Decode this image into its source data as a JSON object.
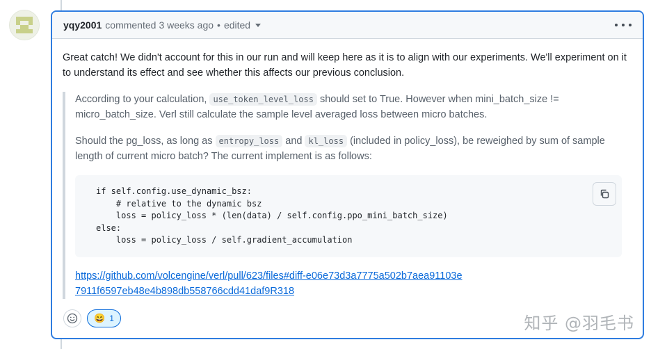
{
  "comment": {
    "author": "yqy2001",
    "action": "commented",
    "time": "3 weeks ago",
    "separator": "•",
    "edited_label": "edited",
    "body_paragraph": "Great catch! We didn't account for this in our run and will keep here as it is to align with our experiments. We'll experiment on it to understand its effect and see whether this affects our previous conclusion.",
    "quote": {
      "p1_part1": "According to your calculation, ",
      "p1_code": "use_token_level_loss",
      "p1_part2": " should set to True. However when mini_batch_size != micro_batch_size. Verl still calculate the sample level averaged loss between micro batches.",
      "p2_part1": "Should the pg_loss, as long as ",
      "p2_code1": "entropy_loss",
      "p2_part2": " and ",
      "p2_code2": "kl_loss",
      "p2_part3": " (included in policy_loss), be reweighed by sum of sample length of current micro batch? The current implement is as follows:",
      "code_block": "if self.config.use_dynamic_bsz:\n    # relative to the dynamic bsz\n    loss = policy_loss * (len(data) / self.config.ppo_mini_batch_size)\nelse:\n    loss = policy_loss / self.gradient_accumulation",
      "link": "https://github.com/volcengine/verl/pull/623/files#diff-e06e73d3a7775a502b7aea91103e7911f6597eb48e4b898db558766cdd41daf9R318"
    },
    "reactions": [
      {
        "emoji": "😄",
        "count": "1"
      }
    ]
  },
  "watermark": "知乎 @羽毛书",
  "icons": {
    "avatar": "identicon-avatar",
    "kebab": "kebab-horizontal-icon",
    "caret": "triangle-down-icon",
    "copy": "copy-icon",
    "add_reaction": "smiley-icon"
  }
}
